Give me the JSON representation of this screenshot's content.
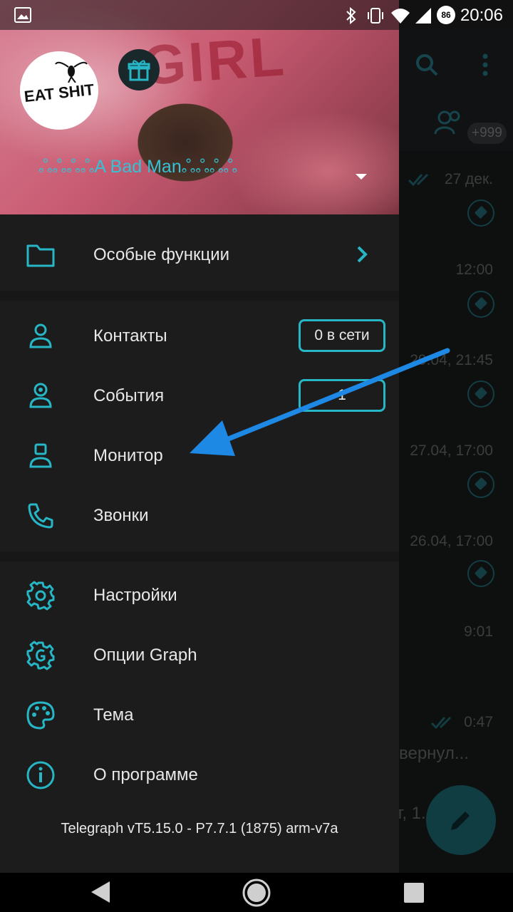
{
  "status_bar": {
    "time": "20:06",
    "battery_level": "86"
  },
  "profile": {
    "username": "ஃஃஃஃA Bad Manஃஃஃஃ",
    "avatar_text": "EAT SHIT",
    "header_art_text": "GIRL"
  },
  "menu": {
    "special": {
      "label": "Особые функции"
    },
    "contacts": {
      "label": "Контакты",
      "badge": "0 в сети"
    },
    "events": {
      "label": "События",
      "badge": "1"
    },
    "monitor": {
      "label": "Монитор"
    },
    "calls": {
      "label": "Звонки"
    },
    "settings": {
      "label": "Настройки"
    },
    "graph": {
      "label": "Опции Graph"
    },
    "theme": {
      "label": "Тема"
    },
    "about": {
      "label": "О программе"
    }
  },
  "version": "Telegraph vT5.15.0 - P7.7.1 (1875) arm-v7a",
  "background": {
    "badge_count": "+999",
    "times": [
      "27 дек.",
      "12:00",
      "29.04, 21:45",
      "27.04, 17:00",
      "26.04, 17:00",
      "9:01",
      "0:47"
    ],
    "snippet_1": "вернул...",
    "snippet_2": "т, 1..."
  },
  "colors": {
    "accent": "#27b6c6",
    "arrow": "#1e88e5",
    "drawer_bg": "#1c1c1c"
  }
}
